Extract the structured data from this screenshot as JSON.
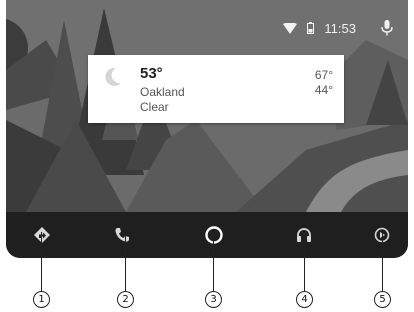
{
  "status": {
    "time": "11:53"
  },
  "weather": {
    "temperature": "53°",
    "city": "Oakland",
    "condition": "Clear",
    "high": "67°",
    "low": "44°"
  },
  "nav": [
    {
      "name": "navigation",
      "icon": "navigation-arrow-icon"
    },
    {
      "name": "phone",
      "icon": "phone-icon"
    },
    {
      "name": "home",
      "icon": "home-circle-icon"
    },
    {
      "name": "audio",
      "icon": "headphones-icon"
    },
    {
      "name": "exit",
      "icon": "exit-icon"
    }
  ],
  "callouts": [
    "1",
    "2",
    "3",
    "4",
    "5"
  ]
}
